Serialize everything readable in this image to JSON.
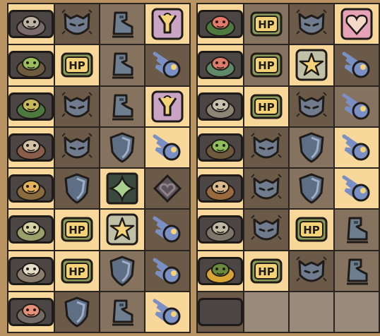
{
  "colors": {
    "background": "#b99462",
    "frame": "#2a2420",
    "cell_light": "#f7d79a",
    "cell_dark": "#6b5a48",
    "cell_mid": "#85735f",
    "hp_green": "#8a9a5b",
    "shield_blue": "#5e6f85",
    "accent_pink": "#e6a3b7",
    "accent_blue": "#7a8fc4",
    "accent_yellow": "#f4d278"
  },
  "hp_label": "HP",
  "left_panel": {
    "rows": [
      {
        "portrait": "snail-monster-portrait",
        "icons": [
          "helmet-icon",
          "boot-icon",
          "jump-icon"
        ],
        "tiles": [
          "dark",
          "mid",
          "hl"
        ]
      },
      {
        "portrait": "tree-stump-monster-portrait",
        "icons": [
          "hp-icon",
          "boot-icon",
          "comet-icon"
        ],
        "tiles": [
          "hl",
          "mid",
          "dark"
        ]
      },
      {
        "portrait": "spiky-plant-monster-portrait",
        "icons": [
          "helmet-icon",
          "boot-icon",
          "jump-icon"
        ],
        "tiles": [
          "dark",
          "mid",
          "hl"
        ]
      },
      {
        "portrait": "mushroom-monster-portrait",
        "icons": [
          "helmet-icon",
          "shield-icon",
          "comet-icon"
        ],
        "tiles": [
          "dark",
          "mid",
          "hl"
        ]
      },
      {
        "portrait": "owl-monster-portrait",
        "icons": [
          "shield-icon",
          "diamond-frame-icon",
          "diamond-heart-icon"
        ],
        "tiles": [
          "dark",
          "hl",
          "dark"
        ]
      },
      {
        "portrait": "mushroom-cap-monster-portrait",
        "icons": [
          "hp-icon",
          "star-icon",
          "comet-icon"
        ],
        "tiles": [
          "hl",
          "hl",
          "dark"
        ]
      },
      {
        "portrait": "ghost-mushroom-monster-portrait",
        "icons": [
          "hp-icon",
          "shield-icon",
          "comet-icon"
        ],
        "tiles": [
          "hl",
          "mid",
          "dark"
        ]
      },
      {
        "portrait": "rock-flower-monster-portrait",
        "icons": [
          "shield-icon",
          "boot-icon",
          "comet-icon"
        ],
        "tiles": [
          "dark",
          "mid",
          "hl"
        ]
      }
    ]
  },
  "right_panel": {
    "rows": [
      {
        "portrait": "carnivorous-plant-portrait",
        "icons": [
          "hp-icon",
          "helmet-icon",
          "heart-icon"
        ],
        "tiles": [
          "mid",
          "dark",
          "hl"
        ]
      },
      {
        "portrait": "dragon-monster-portrait",
        "icons": [
          "hp-icon",
          "star-icon",
          "comet-icon"
        ],
        "tiles": [
          "mid",
          "hl",
          "dark"
        ]
      },
      {
        "portrait": "rock-golem-portrait",
        "icons": [
          "hp-icon",
          "helmet-icon",
          "comet-icon"
        ],
        "tiles": [
          "hl",
          "dark",
          "mid"
        ]
      },
      {
        "portrait": "treant-monster-portrait",
        "icons": [
          "helmet-icon",
          "shield-icon",
          "comet-icon"
        ],
        "tiles": [
          "dark",
          "mid",
          "hl"
        ]
      },
      {
        "portrait": "mushroom-man-portrait",
        "icons": [
          "helmet-icon",
          "shield-icon",
          "comet-icon"
        ],
        "tiles": [
          "dark",
          "mid",
          "hl"
        ]
      },
      {
        "portrait": "stone-block-monster-portrait",
        "icons": [
          "helmet-icon",
          "hp-icon",
          "boot-icon"
        ],
        "tiles": [
          "dark",
          "hl",
          "mid"
        ]
      },
      {
        "portrait": "sunflower-monster-portrait",
        "icons": [
          "hp-icon",
          "helmet-icon",
          "boot-icon"
        ],
        "tiles": [
          "hl",
          "dark",
          "mid"
        ]
      },
      {
        "portrait": "empty-slot-portrait",
        "icons": [
          "",
          "",
          ""
        ],
        "tiles": [
          "empty",
          "empty",
          "empty"
        ]
      }
    ]
  }
}
